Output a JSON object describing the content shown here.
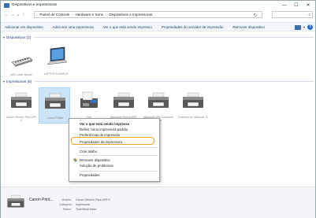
{
  "window": {
    "title": "Dispositivos e impressoras",
    "controls": {
      "minimize": "—",
      "maximize": "☐",
      "close": "✕"
    }
  },
  "address": {
    "back_icon": "←",
    "forward_icon": "→",
    "dropdown_icon": "⌄",
    "up_icon": "↑",
    "breadcrumb": [
      "Painel de Controle",
      "Hardware e Sons",
      "Dispositivos e Impressoras"
    ],
    "separator": "›",
    "refresh_icon": "↻",
    "search_icon": "⌕"
  },
  "commands": [
    "Adicionar um dispositivo",
    "Adicionar uma impressora",
    "Ver o que está sendo impresso",
    "Propriedades do servidor de impressão",
    "Remover dispositivo"
  ],
  "view": {
    "dropdown": "▾",
    "help": "?"
  },
  "groups": {
    "devices": {
      "caret": "▾",
      "label": "Dispositivos (2)"
    },
    "printers": {
      "caret": "▾",
      "label": "Impressoras (6)"
    }
  },
  "devices": [
    {
      "label": "ABC Laser Mouse"
    },
    {
      "label": "LAPTOP-EXAMPLE"
    }
  ],
  "printers": [
    {
      "label": "Canon Generic Plus UFR II"
    },
    {
      "label": "Canon Printer"
    },
    {
      "label": "Fax"
    },
    {
      "label": "Microsoft Print to PDF"
    },
    {
      "label": "Microsoft XPS Document Writer"
    },
    {
      "label": "OneNote for Windows 10"
    }
  ],
  "context_menu": {
    "items": [
      "Ver o que está sendo impresso",
      "Definir como impressora padrão",
      "Preferências de impressão",
      "Propriedades da impressora",
      "Criar atalho",
      "Remover dispositivo",
      "Solução de problemas",
      "Propriedades"
    ]
  },
  "details": {
    "name": "Canon Print...",
    "rows": [
      {
        "key": "Modelo:",
        "value": "Canon Generic Plus UFR II"
      },
      {
        "key": "Categoria:",
        "value": "Impressora"
      },
      {
        "key": "Status:",
        "value": "Toner/tinta baixo"
      }
    ]
  },
  "colors": {
    "accent": "#1e3c78",
    "selection": "#cce4f7",
    "highlight": "#f0a030",
    "command_bar": "#f2f6fa"
  }
}
